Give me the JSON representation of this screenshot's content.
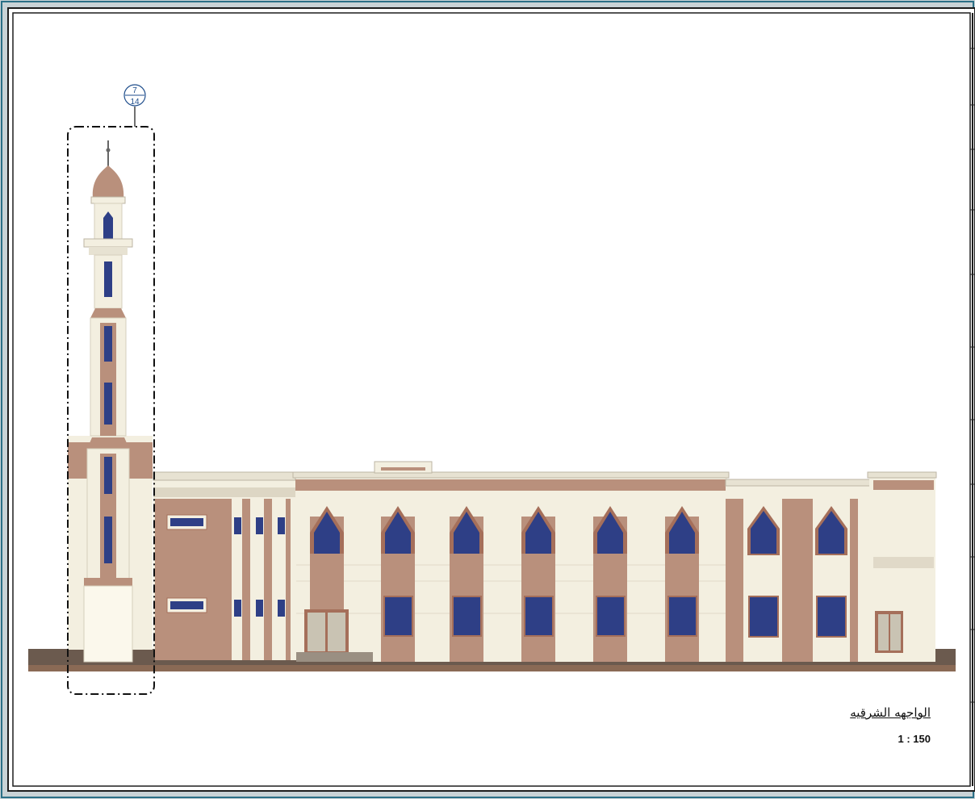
{
  "drawing": {
    "title": "الواجهه الشرقيه",
    "scale": "1 : 150"
  },
  "detail_callout": {
    "detail_number": "7",
    "sheet_number": "14"
  },
  "colors": {
    "wall_cream": "#f3efe0",
    "wall_tan": "#b9907c",
    "trim": "#a56f5a",
    "glass": "#2e3f86",
    "ground": "#6b5a4e",
    "border_blue": "#2a6f86"
  }
}
